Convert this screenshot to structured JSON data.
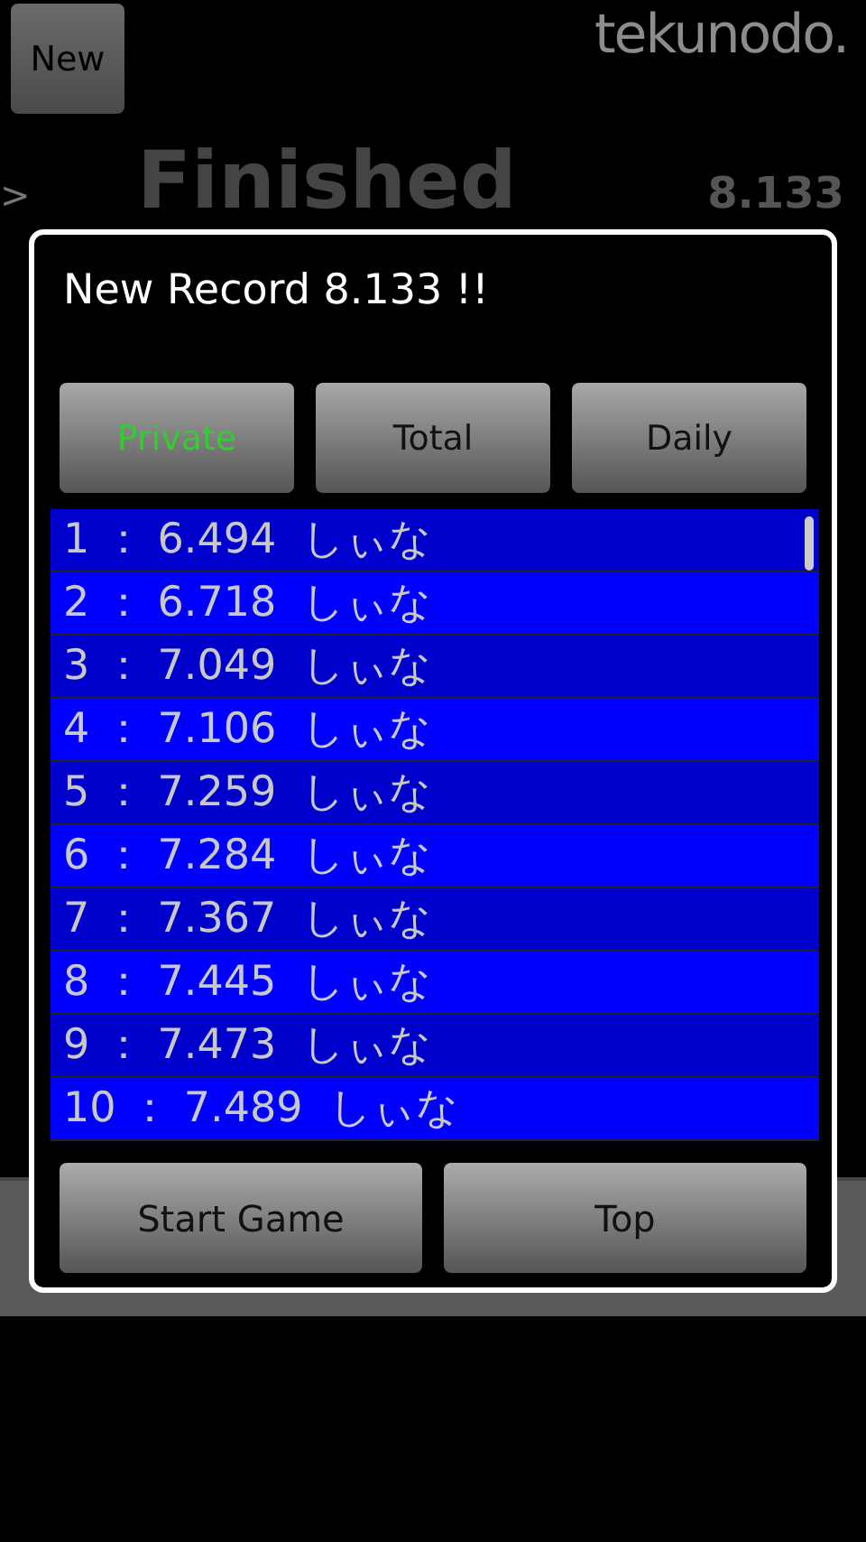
{
  "background": {
    "new_button": "New",
    "logo": "tekunodo.",
    "marker": ">",
    "status": "Finished",
    "time": "8.133"
  },
  "dialog": {
    "title": "New Record 8.133 !!",
    "tabs": [
      {
        "label": "Private",
        "selected": true
      },
      {
        "label": "Total",
        "selected": false
      },
      {
        "label": "Daily",
        "selected": false
      }
    ],
    "records": [
      "1 ： 6.494  しぃな",
      "2 ： 6.718  しぃな",
      "3 ： 7.049  しぃな",
      "4 ： 7.106  しぃな",
      "5 ： 7.259  しぃな",
      "6 ： 7.284  しぃな",
      "7 ： 7.367  しぃな",
      "8 ： 7.445  しぃな",
      "9 ： 7.473  しぃな",
      "10 ： 7.489  しぃな"
    ],
    "buttons": [
      "Start Game",
      "Top"
    ]
  }
}
